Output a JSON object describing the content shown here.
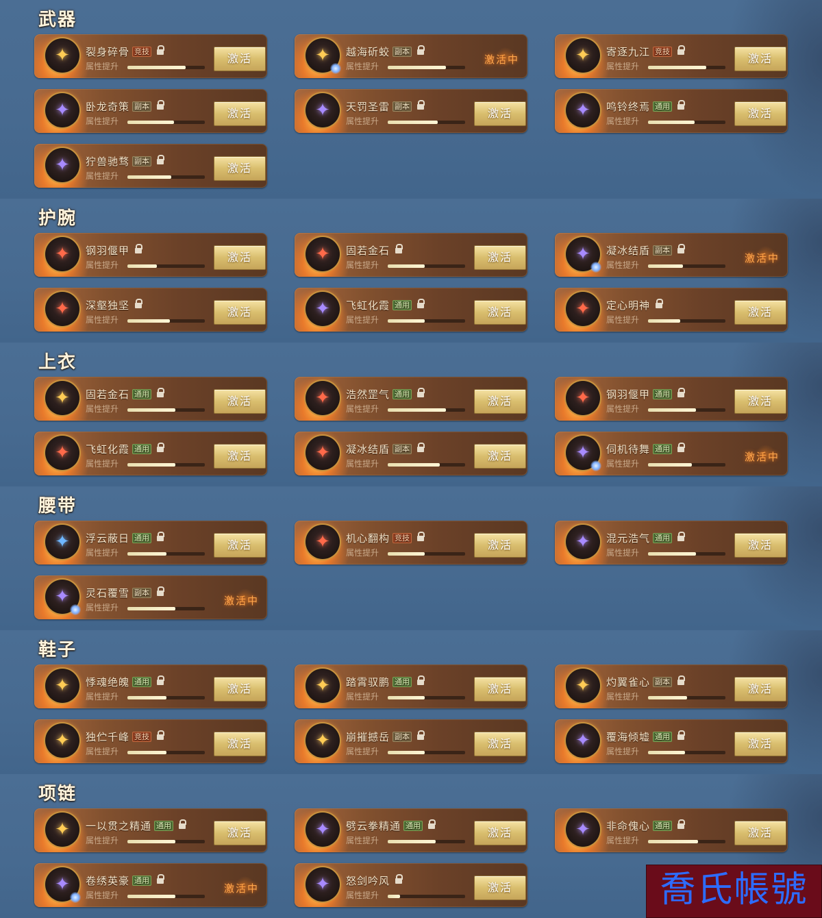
{
  "labels": {
    "sub": "属性提升",
    "button": "激活",
    "active": "激活中"
  },
  "watermark": "喬氏帳號",
  "sections": [
    {
      "title": "武器",
      "items": [
        {
          "name": "裂身碎骨",
          "tag": "竞技",
          "locked": true,
          "progress": 0.75,
          "state": "button",
          "icon_color": "#ffcc55"
        },
        {
          "name": "越海斫蛟",
          "tag": "副本",
          "locked": true,
          "progress": 0.75,
          "state": "active",
          "icon_color": "#ffcc55"
        },
        {
          "name": "寄逐九江",
          "tag": "竞技",
          "locked": true,
          "progress": 0.75,
          "state": "button",
          "icon_color": "#ffcc55"
        },
        {
          "name": "卧龙奇策",
          "tag": "副本",
          "locked": true,
          "progress": 0.6,
          "state": "button",
          "icon_color": "#a88bff"
        },
        {
          "name": "天罚圣雷",
          "tag": "副本",
          "locked": true,
          "progress": 0.65,
          "state": "button",
          "icon_color": "#a88bff"
        },
        {
          "name": "鸣铃终焉",
          "tag": "通用",
          "locked": true,
          "progress": 0.6,
          "state": "button",
          "icon_color": "#a88bff"
        },
        {
          "name": "狞兽驰骛",
          "tag": "副本",
          "locked": true,
          "progress": 0.57,
          "state": "button",
          "icon_color": "#a88bff"
        }
      ]
    },
    {
      "title": "护腕",
      "items": [
        {
          "name": "钢羽偃甲",
          "tag": "",
          "locked": true,
          "progress": 0.38,
          "state": "button",
          "icon_color": "#ff6a4a"
        },
        {
          "name": "固若金石",
          "tag": "",
          "locked": true,
          "progress": 0.48,
          "state": "button",
          "icon_color": "#ff6a4a"
        },
        {
          "name": "凝冰结盾",
          "tag": "副本",
          "locked": true,
          "progress": 0.45,
          "state": "active",
          "icon_color": "#a88bff"
        },
        {
          "name": "深壑独坚",
          "tag": "",
          "locked": true,
          "progress": 0.55,
          "state": "button",
          "icon_color": "#ff6a4a"
        },
        {
          "name": "飞虹化霞",
          "tag": "通用",
          "locked": true,
          "progress": 0.48,
          "state": "button",
          "icon_color": "#a88bff"
        },
        {
          "name": "定心明神",
          "tag": "",
          "locked": true,
          "progress": 0.42,
          "state": "button",
          "icon_color": "#ff6a4a"
        }
      ]
    },
    {
      "title": "上衣",
      "items": [
        {
          "name": "固若金石",
          "tag": "通用",
          "locked": true,
          "progress": 0.62,
          "state": "button",
          "icon_color": "#ffcc55"
        },
        {
          "name": "浩然罡气",
          "tag": "通用",
          "locked": true,
          "progress": 0.75,
          "state": "button",
          "icon_color": "#ff6a4a"
        },
        {
          "name": "钢羽偃甲",
          "tag": "通用",
          "locked": true,
          "progress": 0.62,
          "state": "button",
          "icon_color": "#ff6a4a"
        },
        {
          "name": "飞虹化霞",
          "tag": "通用",
          "locked": true,
          "progress": 0.62,
          "state": "button",
          "icon_color": "#ff6a4a"
        },
        {
          "name": "凝冰结盾",
          "tag": "副本",
          "locked": true,
          "progress": 0.67,
          "state": "button",
          "icon_color": "#ff6a4a"
        },
        {
          "name": "伺机待舞",
          "tag": "通用",
          "locked": true,
          "progress": 0.57,
          "state": "active",
          "icon_color": "#a88bff"
        }
      ]
    },
    {
      "title": "腰带",
      "items": [
        {
          "name": "浮云蔽日",
          "tag": "通用",
          "locked": true,
          "progress": 0.5,
          "state": "button",
          "icon_color": "#6fb7ff"
        },
        {
          "name": "机心翻构",
          "tag": "竞技",
          "locked": true,
          "progress": 0.48,
          "state": "button",
          "icon_color": "#ff6a4a"
        },
        {
          "name": "混元浩气",
          "tag": "通用",
          "locked": true,
          "progress": 0.62,
          "state": "button",
          "icon_color": "#a88bff"
        },
        {
          "name": "灵石覆雪",
          "tag": "副本",
          "locked": true,
          "progress": 0.62,
          "state": "active",
          "icon_color": "#a88bff"
        }
      ]
    },
    {
      "title": "鞋子",
      "items": [
        {
          "name": "悸魂绝魄",
          "tag": "通用",
          "locked": true,
          "progress": 0.5,
          "state": "button",
          "icon_color": "#ffcc55"
        },
        {
          "name": "踏霄驭鹏",
          "tag": "通用",
          "locked": true,
          "progress": 0.48,
          "state": "button",
          "icon_color": "#ffcc55"
        },
        {
          "name": "灼翼雀心",
          "tag": "副本",
          "locked": true,
          "progress": 0.5,
          "state": "button",
          "icon_color": "#ffcc55"
        },
        {
          "name": "独伫千峰",
          "tag": "竞技",
          "locked": true,
          "progress": 0.5,
          "state": "button",
          "icon_color": "#ffcc55"
        },
        {
          "name": "崩摧撼岳",
          "tag": "副本",
          "locked": true,
          "progress": 0.48,
          "state": "button",
          "icon_color": "#ffcc55"
        },
        {
          "name": "覆海倾墟",
          "tag": "通用",
          "locked": true,
          "progress": 0.48,
          "state": "button",
          "icon_color": "#a88bff"
        }
      ]
    },
    {
      "title": "项链",
      "items": [
        {
          "name": "一以贯之精通",
          "tag": "通用",
          "locked": true,
          "progress": 0.62,
          "state": "button",
          "icon_color": "#ffcc55"
        },
        {
          "name": "劈云拳精通",
          "tag": "通用",
          "locked": true,
          "progress": 0.62,
          "state": "button",
          "icon_color": "#a88bff"
        },
        {
          "name": "非命傀心",
          "tag": "通用",
          "locked": true,
          "progress": 0.65,
          "state": "button",
          "icon_color": "#a88bff"
        },
        {
          "name": "卷绣英豪",
          "tag": "通用",
          "locked": true,
          "progress": 0.62,
          "state": "active",
          "icon_color": "#a88bff"
        },
        {
          "name": "怒剑吟风",
          "tag": "",
          "locked": true,
          "progress": 0.16,
          "state": "button",
          "icon_color": "#a88bff"
        }
      ]
    }
  ]
}
